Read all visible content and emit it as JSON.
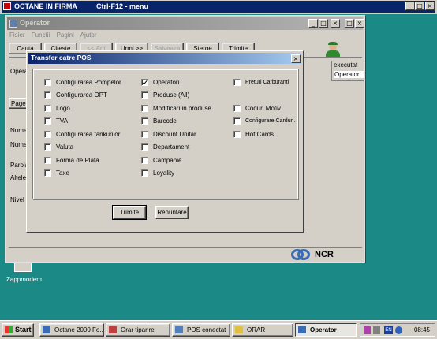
{
  "bg_window": {
    "title": "OCTANE IN FIRMA",
    "shortcut": "Ctrl-F12 - menu"
  },
  "operator_window": {
    "title": "Operator",
    "menu": [
      "Fisier",
      "Functii",
      "Pagini",
      "Ajutor"
    ],
    "toolbar": [
      {
        "label": "Cauta",
        "enabled": true
      },
      {
        "label": "Citeste",
        "enabled": true
      },
      {
        "label": "<< Ant",
        "enabled": false
      },
      {
        "label": "Urml >>",
        "enabled": true
      },
      {
        "label": "Salveaza",
        "enabled": false
      },
      {
        "label": "Sterge",
        "enabled": true
      },
      {
        "label": "Trimite",
        "enabled": true
      }
    ],
    "side_labels": [
      "Opera",
      "Page",
      "Nume",
      "Nume",
      "Parola",
      "Altele",
      "Nivel"
    ],
    "right_panel": [
      "executat",
      "Operatori"
    ],
    "brand": "NCR"
  },
  "dialog": {
    "title": "Transfer catre POS",
    "checkboxes": [
      {
        "label": "Configurarea Pompelor",
        "checked": false,
        "col": 0,
        "row": 0
      },
      {
        "label": "Configurarea OPT",
        "checked": false,
        "col": 0,
        "row": 1
      },
      {
        "label": "Logo",
        "checked": false,
        "col": 0,
        "row": 2
      },
      {
        "label": "TVA",
        "checked": false,
        "col": 0,
        "row": 3
      },
      {
        "label": "Configurarea tankurilor",
        "checked": false,
        "col": 0,
        "row": 4
      },
      {
        "label": "Valuta",
        "checked": false,
        "col": 0,
        "row": 5
      },
      {
        "label": "Forma de Plata",
        "checked": false,
        "col": 0,
        "row": 6
      },
      {
        "label": "Taxe",
        "checked": false,
        "col": 0,
        "row": 7
      },
      {
        "label": "Operatori",
        "checked": true,
        "col": 1,
        "row": 0
      },
      {
        "label": "Produse (All)",
        "checked": false,
        "col": 1,
        "row": 1
      },
      {
        "label": "Modificari in produse",
        "checked": false,
        "col": 1,
        "row": 2
      },
      {
        "label": "Barcode",
        "checked": false,
        "col": 1,
        "row": 3
      },
      {
        "label": "Discount Unitar",
        "checked": false,
        "col": 1,
        "row": 4
      },
      {
        "label": "Departament",
        "checked": false,
        "col": 1,
        "row": 5
      },
      {
        "label": "Campanie",
        "checked": false,
        "col": 1,
        "row": 6
      },
      {
        "label": "Loyality",
        "checked": false,
        "col": 1,
        "row": 7
      },
      {
        "label": "Preturi Carburanti",
        "checked": false,
        "col": 2,
        "row": 0
      },
      {
        "label": "Coduri Motiv",
        "checked": false,
        "col": 2,
        "row": 2
      },
      {
        "label": "Configurare Carduri.",
        "checked": false,
        "col": 2,
        "row": 3
      },
      {
        "label": "Hot Cards",
        "checked": false,
        "col": 2,
        "row": 4
      }
    ],
    "buttons": {
      "send": "Trimite",
      "cancel": "Renuntare"
    }
  },
  "desktop": {
    "icon_label": "Zappmodem"
  },
  "taskbar": {
    "start": "Start",
    "tasks": [
      {
        "label": "Octane 2000 Fo...",
        "active": false
      },
      {
        "label": "Orar tiparire",
        "active": false
      },
      {
        "label": "POS conectat",
        "active": false
      },
      {
        "label": "ORAR",
        "active": false
      },
      {
        "label": "Operator",
        "active": true
      }
    ],
    "lang": "EN",
    "clock": "08:45"
  }
}
